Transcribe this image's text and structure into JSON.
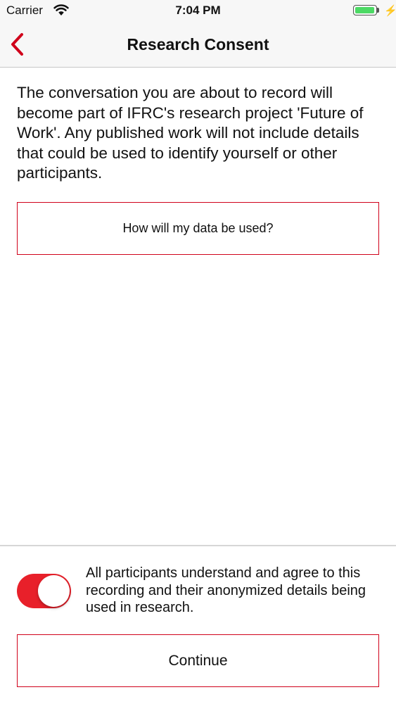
{
  "status_bar": {
    "carrier": "Carrier",
    "time": "7:04 PM",
    "battery_level": 1.0,
    "battery_color": "#4cd964"
  },
  "nav": {
    "title": "Research Consent",
    "accent_color": "#d0021b"
  },
  "body": {
    "intro": "The conversation you are about to record will become part of IFRC's research project 'Future of Work'. Any published work will not include details that could be used to identify yourself or other participants.",
    "data_usage_button_label": "How will my data be used?"
  },
  "consent": {
    "toggle_on": true,
    "toggle_color": "#e8202a",
    "text": "All participants understand and agree to this recording and their anonymized details being used in research."
  },
  "footer": {
    "continue_label": "Continue"
  }
}
